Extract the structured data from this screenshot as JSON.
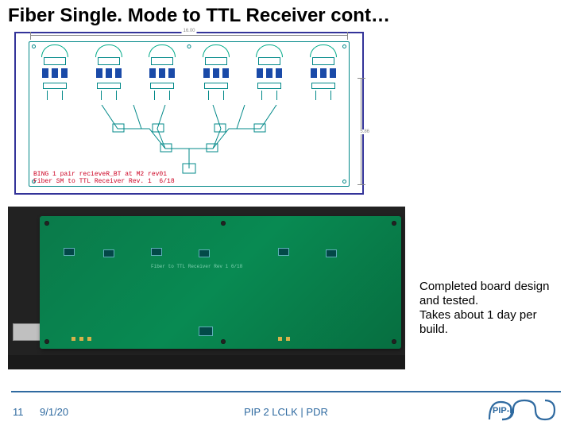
{
  "slide": {
    "title": "Fiber Single. Mode to TTL Receiver cont…",
    "caption": "Completed board design and tested.\nTakes about 1 day per build."
  },
  "schematic": {
    "dim_top": "16.00",
    "dim_right": "5.86",
    "label_line1": "BING 1 pair recieveR_BT at M2 rev01",
    "label_line2": "Fiber SM to TTL Receiver Rev. 1  6/18"
  },
  "board": {
    "silk_text": "Fiber to TTL Receiver   Rev 1   6/18"
  },
  "footer": {
    "page_number": "11",
    "date": "9/1/20",
    "doc_ref": "PIP 2 LCLK | PDR",
    "logo_text": "PIP-II"
  },
  "colors": {
    "accent": "#2f6aa0",
    "pcb_green": "#088a52",
    "schematic_border": "#333399"
  }
}
